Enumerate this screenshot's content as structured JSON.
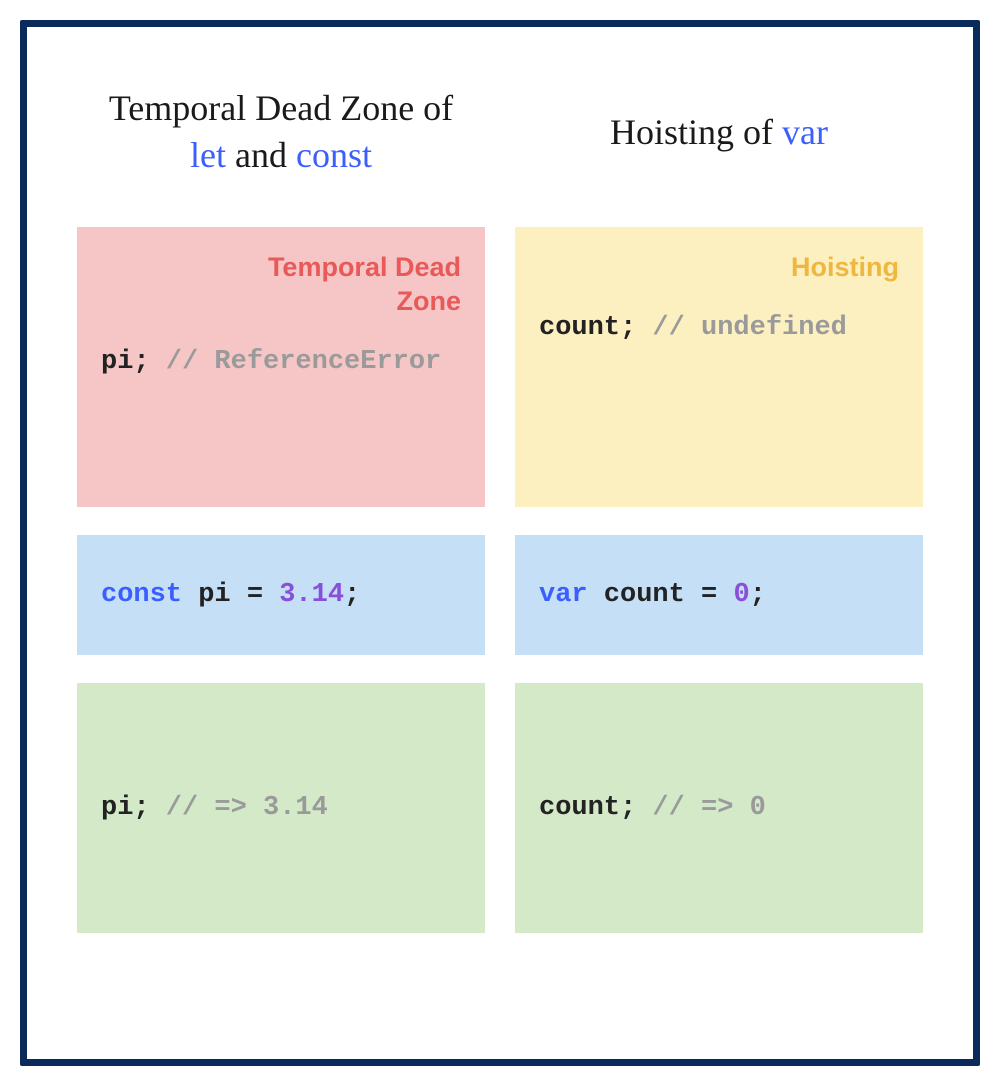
{
  "left": {
    "title_pre": "Temporal Dead Zone of ",
    "kw1": "let",
    "title_mid": " and ",
    "kw2": "const",
    "box1_label": "Temporal Dead Zone",
    "box1_code_var": "pi;",
    "box1_code_comment": " // ReferenceError",
    "box2_kw": "const",
    "box2_var": " pi = ",
    "box2_num": "3.14",
    "box2_end": ";",
    "box3_var": "pi;",
    "box3_comment": " // => 3.14"
  },
  "right": {
    "title_pre": "Hoisting of ",
    "kw1": "var",
    "box1_label": "Hoisting",
    "box1_code_var": "count;",
    "box1_code_comment": " // undefined",
    "box2_kw": "var",
    "box2_var": " count = ",
    "box2_num": "0",
    "box2_end": ";",
    "box3_var": "count;",
    "box3_comment": " // => 0"
  }
}
